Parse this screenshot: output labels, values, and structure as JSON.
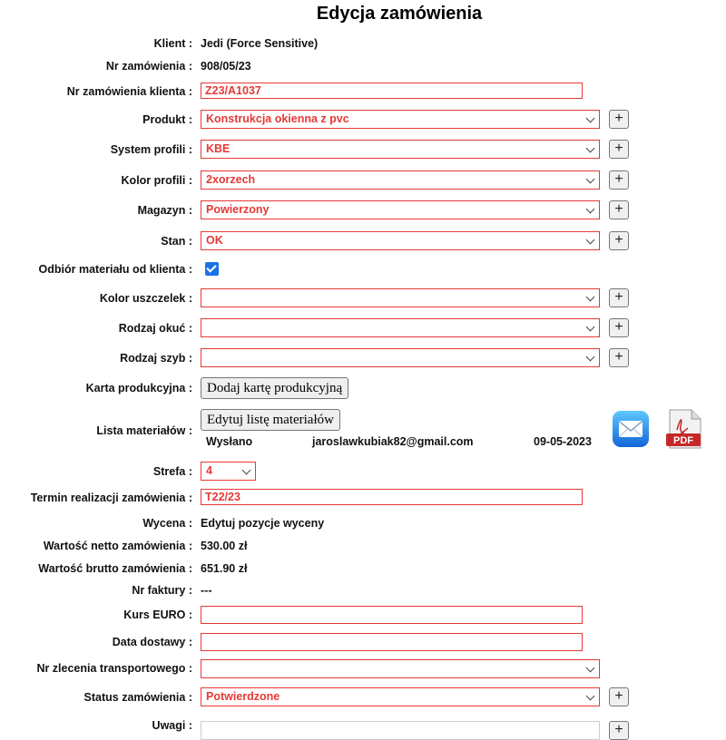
{
  "title": "Edycja zamówienia",
  "fields": {
    "klient": {
      "label": "Klient :",
      "value": "Jedi (Force Sensitive)"
    },
    "nr_zamowienia": {
      "label": "Nr zamówienia :",
      "value": "908/05/23"
    },
    "nr_zamowienia_klienta": {
      "label": "Nr zamówienia klienta :",
      "value": "Z23/A1037"
    },
    "produkt": {
      "label": "Produkt :",
      "value": "Konstrukcja okienna z pvc"
    },
    "system_profili": {
      "label": "System profili :",
      "value": "KBE"
    },
    "kolor_profili": {
      "label": "Kolor profili :",
      "value": "2xorzech"
    },
    "magazyn": {
      "label": "Magazyn :",
      "value": "Powierzony"
    },
    "stan": {
      "label": "Stan :",
      "value": "OK"
    },
    "odbior_materialu": {
      "label": "Odbiór materiału od klienta :",
      "checked": true
    },
    "kolor_uszczelek": {
      "label": "Kolor uszczelek :",
      "value": ""
    },
    "rodzaj_okuc": {
      "label": "Rodzaj okuć :",
      "value": ""
    },
    "rodzaj_szyb": {
      "label": "Rodzaj szyb :",
      "value": ""
    },
    "karta_produkcyjna": {
      "label": "Karta produkcyjna :",
      "button": "Dodaj kartę produkcyjną"
    },
    "lista_materialow": {
      "label": "Lista materiałów :",
      "button": "Edytuj listę materiałów",
      "status": "Wysłano",
      "email": "jaroslawkubiak82@gmail.com",
      "date": "09-05-2023",
      "pdf_text": "PDF"
    },
    "strefa": {
      "label": "Strefa :",
      "value": "4"
    },
    "termin_realizacji": {
      "label": "Termin realizacji zamówienia :",
      "value": "T22/23"
    },
    "wycena": {
      "label": "Wycena :",
      "value": "Edytuj pozycje wyceny"
    },
    "wartosc_netto": {
      "label": "Wartość netto zamówienia :",
      "value": "530.00 zł"
    },
    "wartosc_brutto": {
      "label": "Wartość brutto zamówienia :",
      "value": "651.90 zł"
    },
    "nr_faktury": {
      "label": "Nr faktury :",
      "value": "---"
    },
    "kurs_euro": {
      "label": "Kurs EURO :",
      "value": ""
    },
    "data_dostawy": {
      "label": "Data dostawy :",
      "value": ""
    },
    "nr_zlecenia_transportowego": {
      "label": "Nr zlecenia transportowego :",
      "value": ""
    },
    "status_zamowienia": {
      "label": "Status zamówienia :",
      "value": "Potwierdzone"
    },
    "uwagi": {
      "label": "Uwagi :"
    }
  },
  "add_button_label": "+",
  "colors": {
    "accent": "#e53935",
    "checkbox": "#1a73e8"
  }
}
